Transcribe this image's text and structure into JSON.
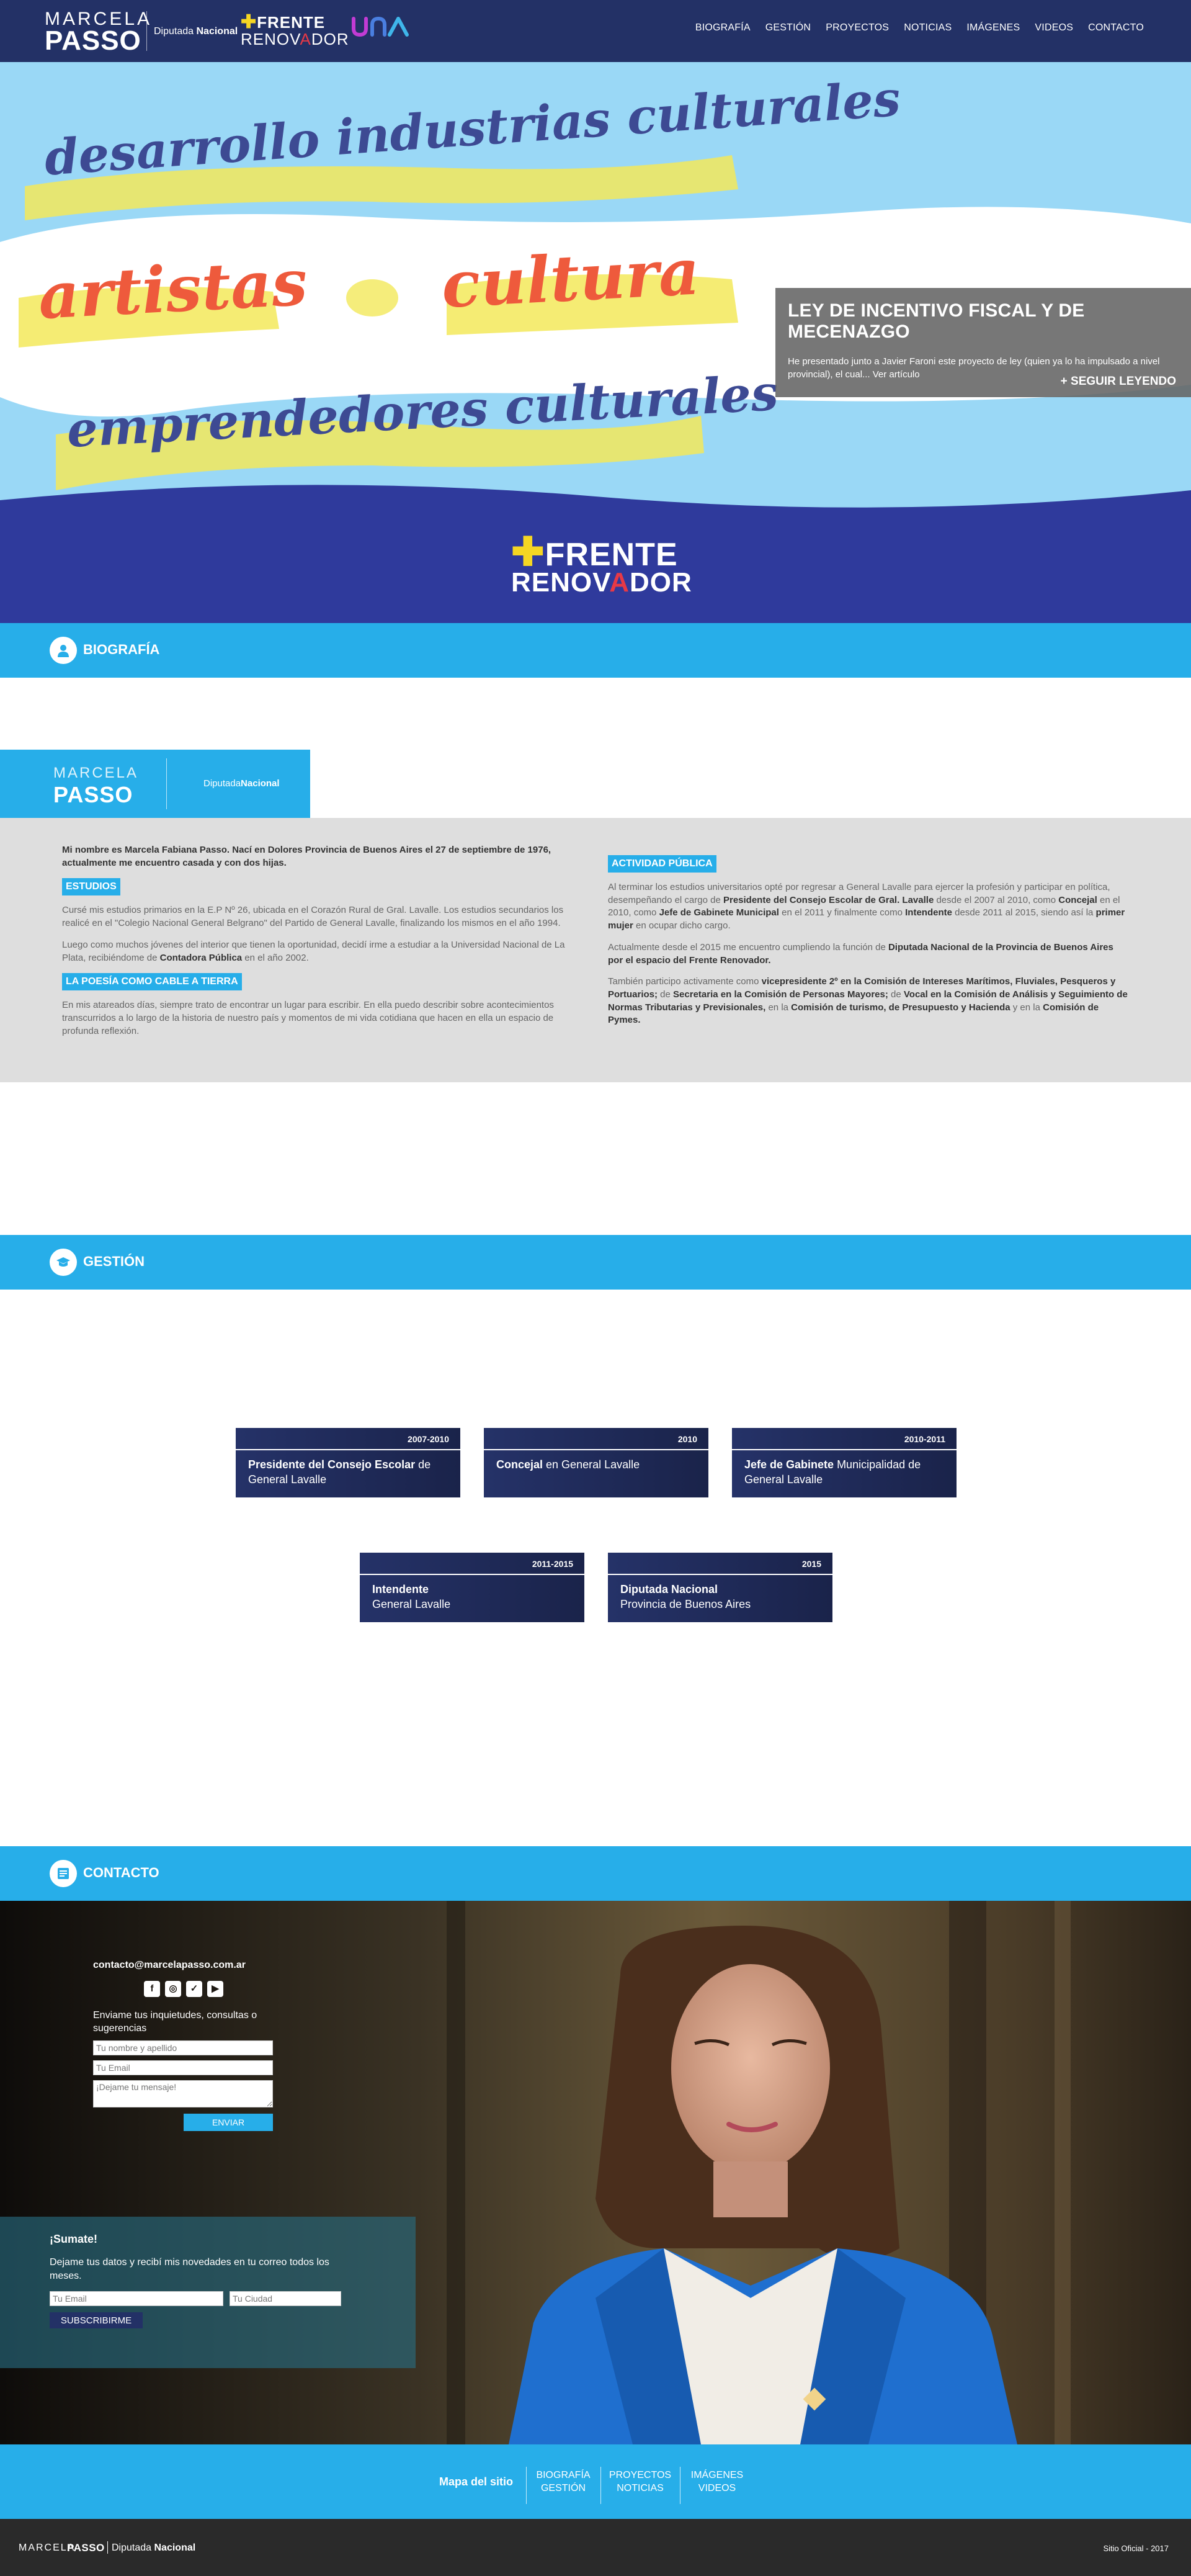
{
  "header": {
    "logo_first": "MARCELA",
    "logo_last": "PASSO",
    "role_prefix": "Diputada",
    "role_bold": "Nacional",
    "party_line1": "FRENTE",
    "party_line2_a": "RENOV",
    "party_line2_b": "A",
    "party_line2_c": "DOR",
    "nav": [
      "BIOGRAFÍA",
      "GESTIÓN",
      "PROYECTOS",
      "NOTICIAS",
      "IMÁGENES",
      "VIDEOS",
      "CONTACTO"
    ]
  },
  "hero": {
    "line1": "desarrollo industrias culturales",
    "line2a": "artistas",
    "line2b": "cultura",
    "line3": "emprendedores culturales",
    "news_title": "LEY DE INCENTIVO FISCAL Y DE MECENAZGO",
    "news_text": "He presentado junto a Javier Faroni este proyecto de ley (quien ya lo ha impulsado a nivel provincial), el cual... Ver artículo",
    "news_more": "+ SEGUIR LEYENDO",
    "party_line1": "FRENTE",
    "party_line2_a": "RENOV",
    "party_line2_b": "A",
    "party_line2_c": "DOR"
  },
  "bio": {
    "section_title": "BIOGRAFÍA",
    "badge_first": "MARCELA",
    "badge_last": "PASSO",
    "badge_role_a": "Diputada",
    "badge_role_b": "Nacional",
    "intro": "Mi nombre es Marcela Fabiana Passo. Nací en Dolores Provincia de Buenos Aires el 27 de septiembre de 1976, actualmente me encuentro casada y con dos hijas.",
    "tag_studies": "ESTUDIOS",
    "studies_p1": "Cursé mis estudios primarios en la E.P Nº 26, ubicada en el Corazón Rural de Gral. Lavalle. Los estudios secundarios los realicé en el \"Colegio Nacional General Belgrano\" del Partido de General Lavalle, finalizando los mismos en el año 1994.",
    "studies_p2_a": "Luego como muchos jóvenes del interior que tienen la oportunidad, decidí irme a estudiar a la Universidad Nacional de La Plata, recibiéndome de ",
    "studies_p2_b": "Contadora Pública",
    "studies_p2_c": " en el año 2002.",
    "tag_poetry": "LA POESÍA COMO CABLE A TIERRA",
    "poetry_p": "En mis atareados días, siempre trato de encontrar un lugar para escribir. En ella puedo describir sobre acontecimientos transcurridos a lo largo de la historia de nuestro país y momentos de mi vida cotidiana que hacen en ella un espacio de profunda reflexión.",
    "tag_public": "ACTIVIDAD PÚBLICA",
    "public_p1_a": "Al terminar los estudios universitarios opté por regresar a General Lavalle para ejercer la profesión y participar en política, desempeñando el cargo de ",
    "public_p1_b": "Presidente del Consejo Escolar de Gral. Lavalle",
    "public_p1_c": " desde el 2007 al 2010, como ",
    "public_p1_d": "Concejal",
    "public_p1_e": " en el 2010, como ",
    "public_p1_f": "Jefe de Gabinete Municipal",
    "public_p1_g": " en el 2011 y finalmente como ",
    "public_p1_h": "Intendente",
    "public_p1_i": " desde 2011 al 2015, siendo así la ",
    "public_p1_j": "primer mujer",
    "public_p1_k": " en ocupar dicho cargo.",
    "public_p2_a": "Actualmente desde el 2015 me encuentro cumpliendo la función de ",
    "public_p2_b": "Diputada Nacional de la Provincia de Buenos Aires por el espacio del Frente Renovador.",
    "public_p3_a": "También participo activamente como ",
    "public_p3_b": "vicepresidente 2º en la Comisión de Intereses Marítimos, Fluviales, Pesqueros y Portuarios;",
    "public_p3_c": " de ",
    "public_p3_d": "Secretaria en la Comisión de Personas Mayores;",
    "public_p3_e": " de ",
    "public_p3_f": "Vocal en la Comisión de Análisis y Seguimiento de Normas Tributarias y Previsionales,",
    "public_p3_g": " en la ",
    "public_p3_h": "Comisión de turismo, de Presupuesto y Hacienda",
    "public_p3_i": " y en la ",
    "public_p3_j": "Comisión de Pymes."
  },
  "gestion": {
    "section_title": "GESTIÓN",
    "cards": [
      {
        "year": "2007-2010",
        "bold": "Presidente del Consejo Escolar",
        "rest": " de General Lavalle"
      },
      {
        "year": "2010",
        "bold": "Concejal",
        "rest": " en General Lavalle"
      },
      {
        "year": "2010-2011",
        "bold": "Jefe de Gabinete",
        "rest": " Municipalidad de General Lavalle"
      },
      {
        "year": "2011-2015",
        "bold": "Intendente",
        "rest": "General Lavalle"
      },
      {
        "year": "2015",
        "bold": "Diputada Nacional",
        "rest": "Provincia de Buenos Aires"
      }
    ]
  },
  "contacto": {
    "section_title": "CONTACTO",
    "email": "contacto@marcelapasso.com.ar",
    "socials": [
      "facebook-icon",
      "instagram-icon",
      "twitter-icon",
      "youtube-icon"
    ],
    "form_msg": "Enviame tus inquietudes, consultas o sugerencias",
    "placeholder_name": "Tu nombre y apellido",
    "placeholder_email": "Tu Email",
    "placeholder_message": "¡Dejame tu mensaje!",
    "send_label": "ENVIAR",
    "sumate_title": "¡Sumate!",
    "sumate_text": "Dejame tus datos y recibí mis novedades en tu correo todos los meses.",
    "sumate_email_ph": "Tu Email",
    "sumate_city_ph": "Tu Ciudad",
    "subscribe_label": "SUBSCRIBIRME"
  },
  "footer": {
    "sitemap_label": "Mapa del sitio",
    "col1": [
      "BIOGRAFÍA",
      "GESTIÓN"
    ],
    "col2": [
      "PROYECTOS",
      "NOTICIAS"
    ],
    "col3": [
      "IMÁGENES",
      "VIDEOS"
    ],
    "bottom_first": "MARCELA",
    "bottom_last": "PASSO",
    "bottom_role_a": "Diputada",
    "bottom_role_b": "Nacional",
    "official": "Sitio Oficial - 2017"
  },
  "colors": {
    "navy": "#233166",
    "sky": "#27aee9",
    "hero_bg": "#9ad8f6",
    "yellow": "#f5d623",
    "coral": "#ee5a3c",
    "indigo": "#3d4a93"
  }
}
